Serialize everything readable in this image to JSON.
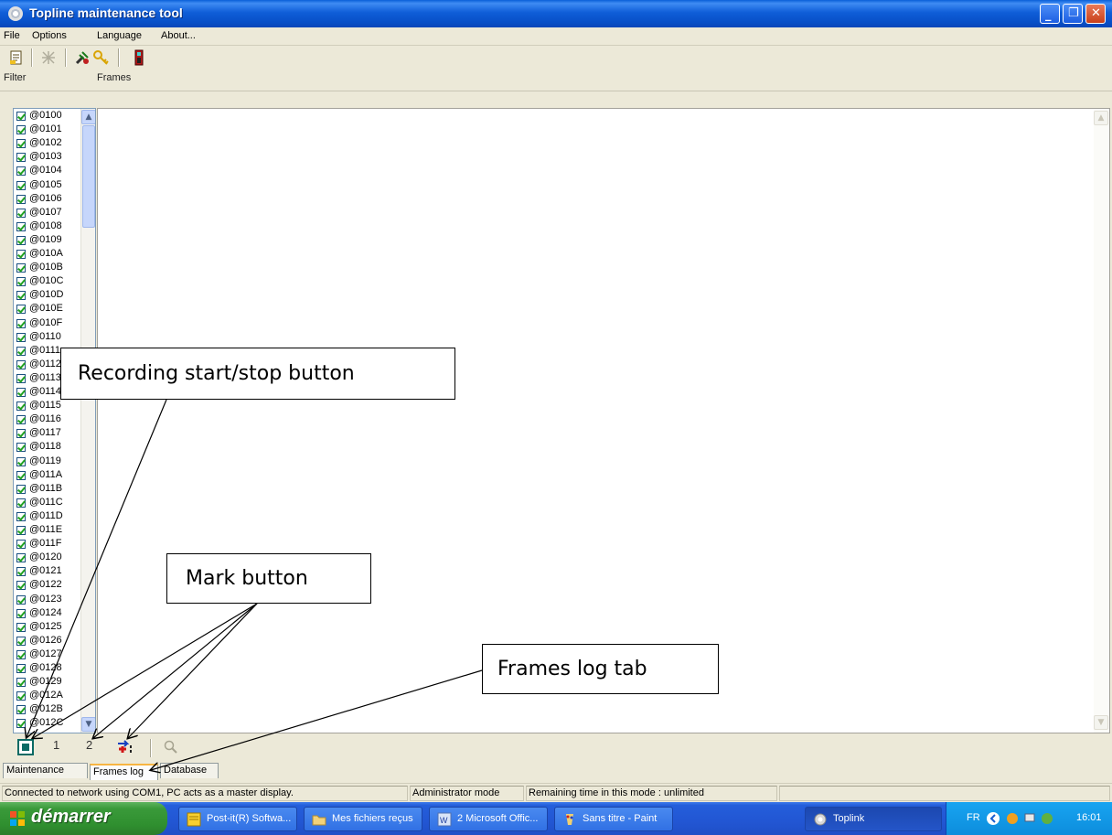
{
  "window": {
    "title": "Topline maintenance tool"
  },
  "menu": [
    "File",
    "Options",
    "Language",
    "About..."
  ],
  "toolbar": {
    "icons": [
      "new-document-icon",
      "disabled-tool-icon",
      "tools-icon",
      "key-icon",
      "device-icon"
    ]
  },
  "panels": {
    "filter_label": "Filter",
    "frames_label": "Frames"
  },
  "filter_items": [
    "@0100",
    "@0101",
    "@0102",
    "@0103",
    "@0104",
    "@0105",
    "@0106",
    "@0107",
    "@0108",
    "@0109",
    "@010A",
    "@010B",
    "@010C",
    "@010D",
    "@010E",
    "@010F",
    "@0110",
    "@0111",
    "@0112",
    "@0113",
    "@0114",
    "@0115",
    "@0116",
    "@0117",
    "@0118",
    "@0119",
    "@011A",
    "@011B",
    "@011C",
    "@011D",
    "@011E",
    "@011F",
    "@0120",
    "@0121",
    "@0122",
    "@0123",
    "@0124",
    "@0125",
    "@0126",
    "@0127",
    "@0128",
    "@0129",
    "@012A",
    "@012B",
    "@012C"
  ],
  "bottom_toolbar": {
    "mark1": "1",
    "mark2": "2"
  },
  "tabs": [
    {
      "label": "Maintenance",
      "active": false
    },
    {
      "label": "Frames log",
      "active": true
    },
    {
      "label": "Database",
      "active": false
    }
  ],
  "status": {
    "connection": "Connected to network using COM1, PC acts as a master display.",
    "mode": "Administrator mode",
    "remaining": "Remaining time in this mode : unlimited"
  },
  "taskbar": {
    "start": "démarrer",
    "tasks": [
      {
        "label": "Post-it(R) Softwa...",
        "icon": "post-it-icon"
      },
      {
        "label": "Mes fichiers reçus",
        "icon": "folder-icon"
      },
      {
        "label": "2 Microsoft Offic...",
        "icon": "office-icon"
      },
      {
        "label": "Sans titre - Paint",
        "icon": "paint-icon"
      },
      {
        "label": "Toplink",
        "icon": "gear-icon"
      }
    ],
    "tray_lang": "FR",
    "clock": "16:01"
  },
  "annotations": {
    "recording": "Recording start/stop button",
    "mark": "Mark button",
    "frames_tab": "Frames log tab"
  },
  "colors": {
    "title_bar": "#0a5fd8",
    "face": "#ece9d8",
    "start_button": "#3a9a3a",
    "active_tab_accent": "#f7b542"
  }
}
